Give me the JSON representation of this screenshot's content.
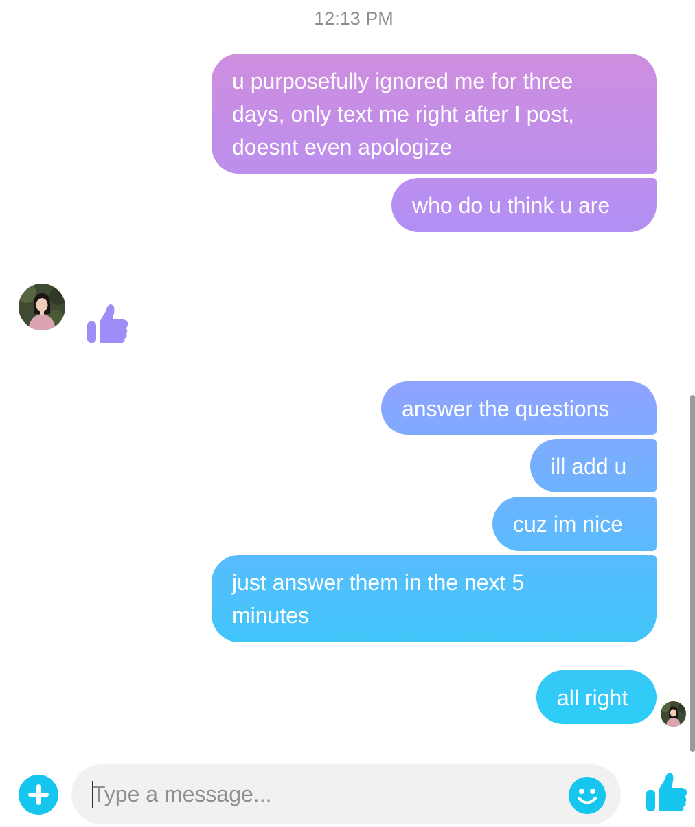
{
  "conversation": {
    "timestamp": "12:13 PM",
    "messages": [
      {
        "text": "u purposefully ignored me for three\ndays, only text me right after I post,\ndoesnt even apologize"
      },
      {
        "text": "who do u think u are"
      },
      {
        "text": "answer the questions"
      },
      {
        "text": "ill add u"
      },
      {
        "text": "cuz im nice"
      },
      {
        "text": "just answer them in the next 5\nminutes"
      },
      {
        "text": "all right"
      }
    ],
    "reaction_icon": "thumbs-up-icon",
    "reaction_color": "#a08cf7"
  },
  "composer": {
    "placeholder": "Type a message...",
    "value": "",
    "accent_color": "#17c6ee",
    "add_icon": "plus-icon",
    "emoji_icon": "smiley-icon",
    "like_icon": "thumbs-up-icon"
  },
  "colors": {
    "bubble_gradient": [
      "#d78ed7",
      "#b38ff4",
      "#8fa3ff",
      "#52bffc",
      "#29cdf5"
    ],
    "timestamp": "#8a8d91"
  }
}
